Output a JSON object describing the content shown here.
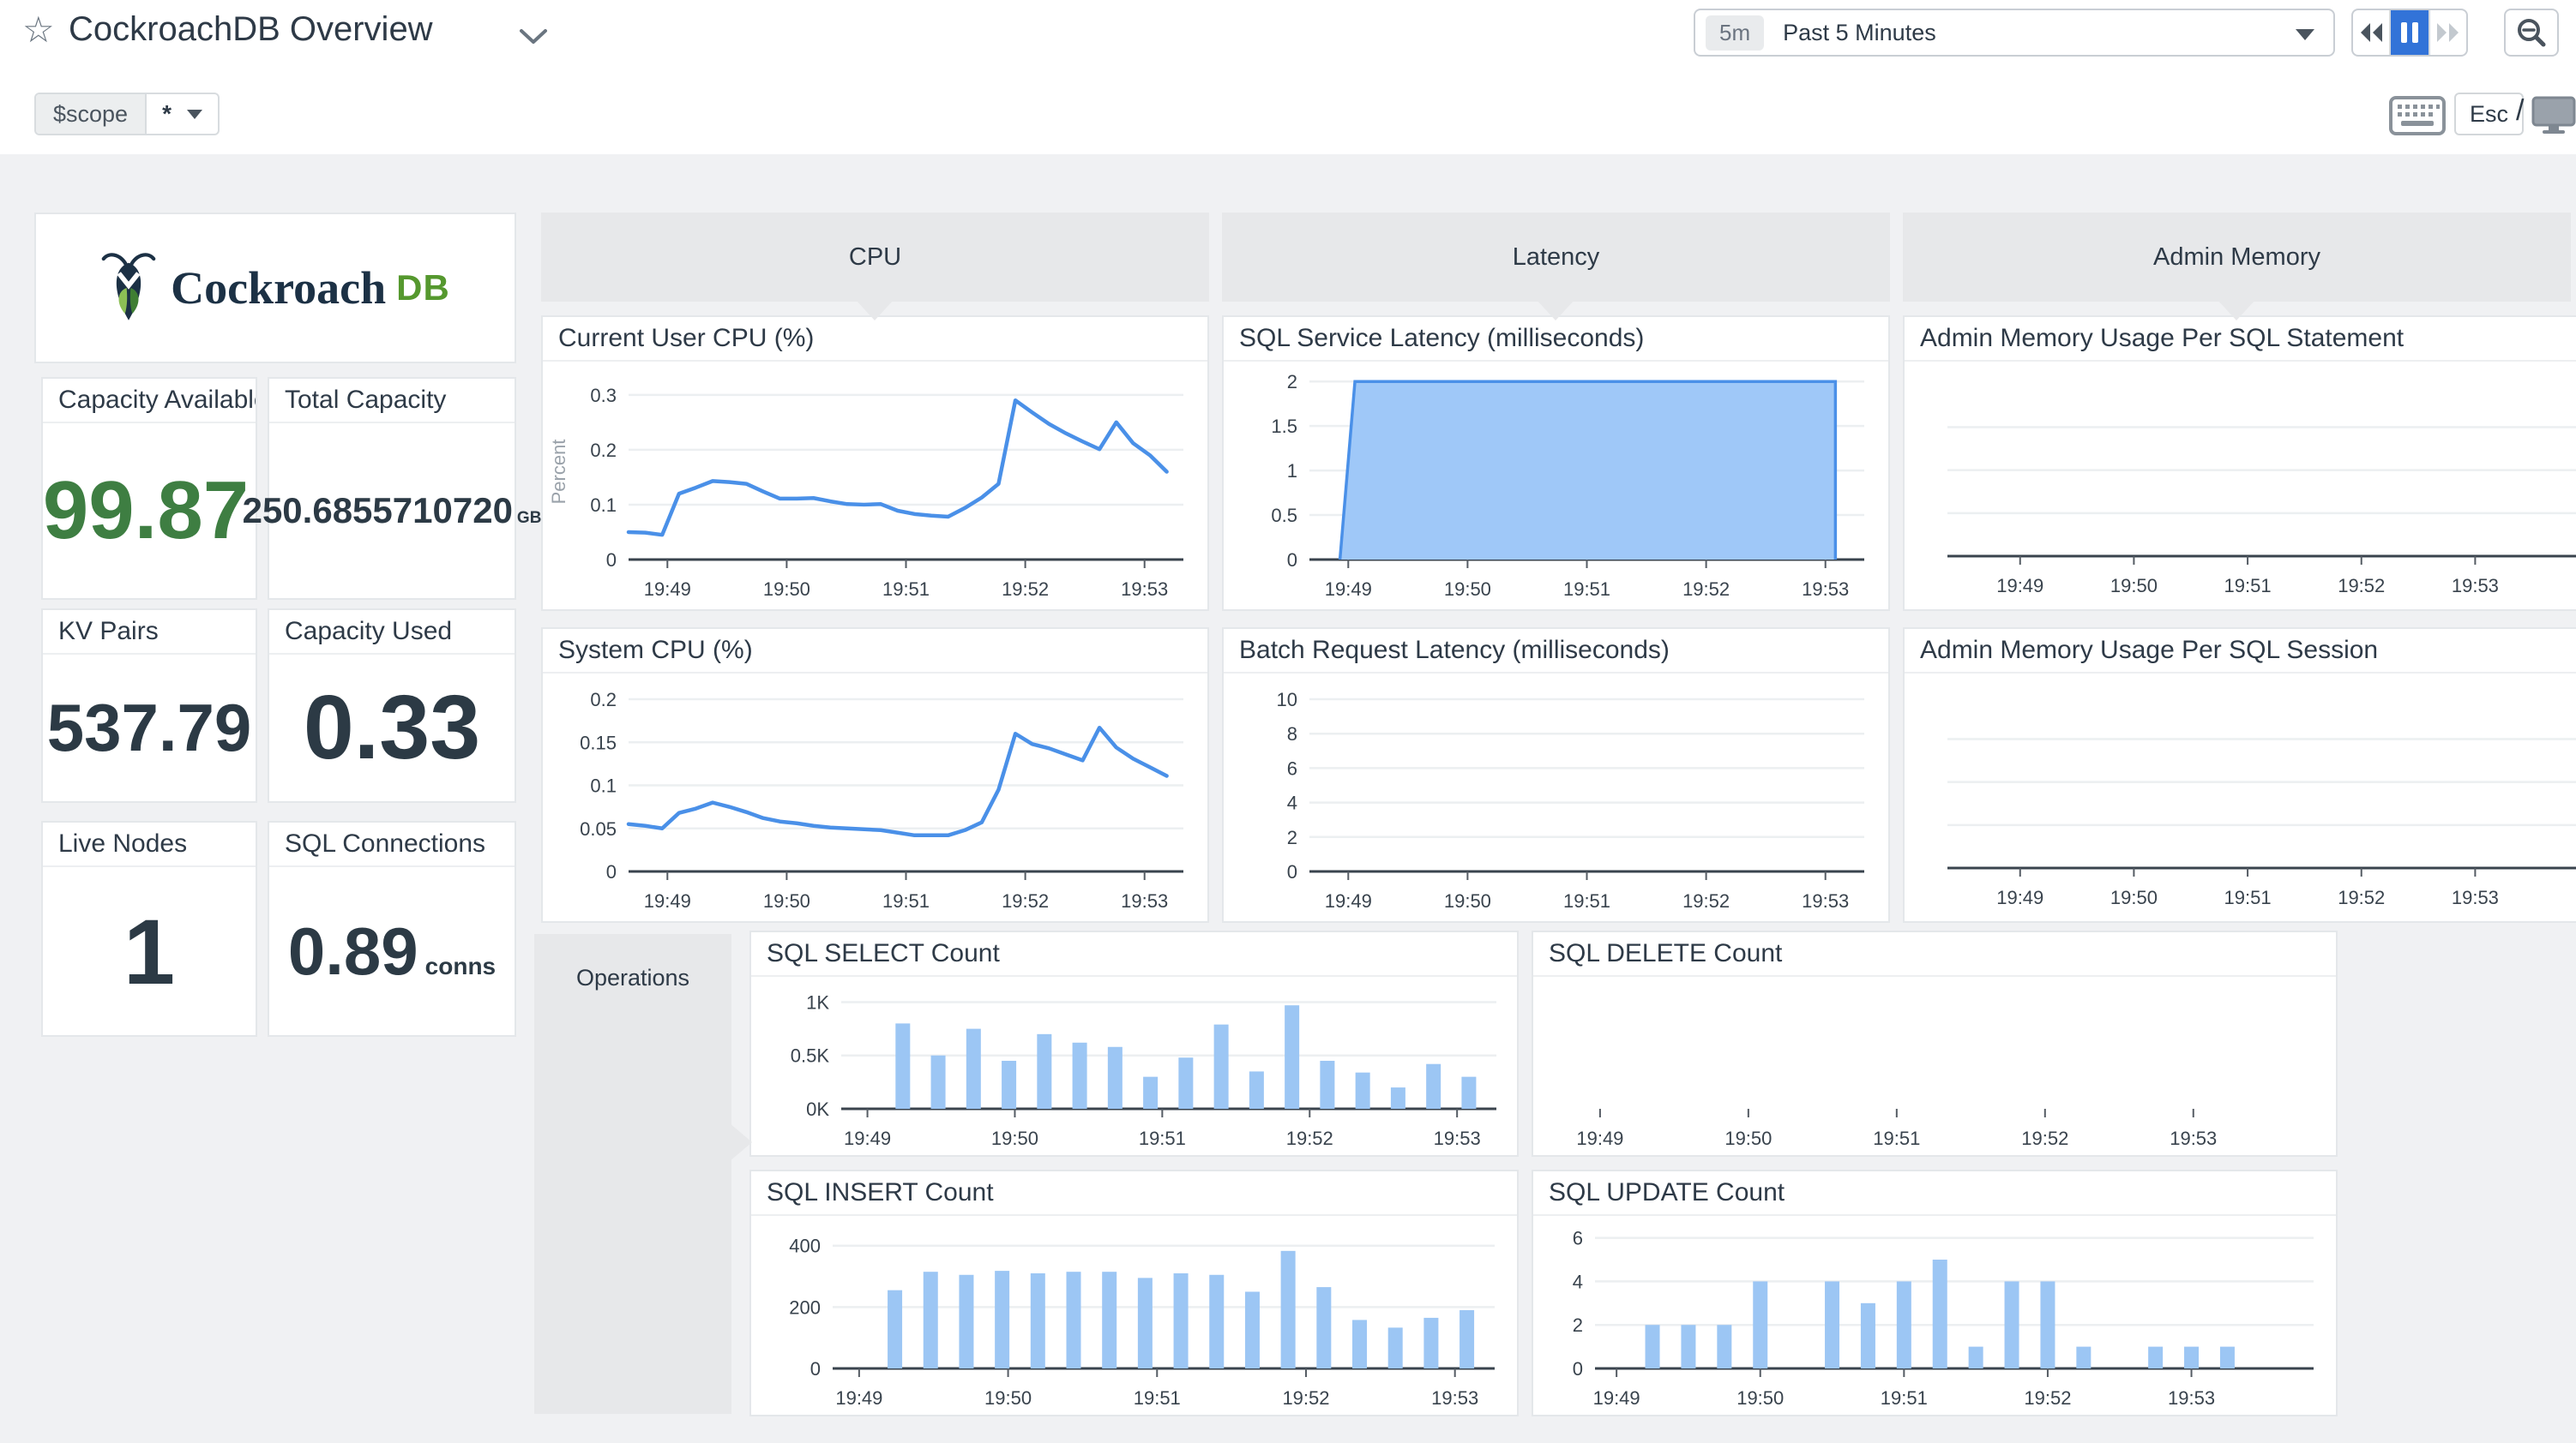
{
  "header": {
    "title": "CockroachDB Overview",
    "time_badge": "5m",
    "time_label": "Past 5 Minutes",
    "esc_label": "Esc",
    "slash": "/"
  },
  "template_vars": {
    "scope_label": "$scope",
    "scope_value": "*"
  },
  "branding": {
    "logo_text": "Cockroach",
    "logo_suffix": "DB"
  },
  "groups": {
    "cpu": "CPU",
    "latency": "Latency",
    "admin_memory": "Admin Memory",
    "operations": "Operations"
  },
  "stats": [
    {
      "id": "capacity-available",
      "title": "Capacity Available...",
      "value": "99.87",
      "unit": ""
    },
    {
      "id": "total-capacity",
      "title": "Total Capacity",
      "value": "250.6855710720",
      "unit": "GB"
    },
    {
      "id": "kv-pairs",
      "title": "KV Pairs",
      "value": "537.79",
      "unit": ""
    },
    {
      "id": "capacity-used",
      "title": "Capacity Used",
      "value": "0.33",
      "unit": ""
    },
    {
      "id": "live-nodes",
      "title": "Live Nodes",
      "value": "1",
      "unit": ""
    },
    {
      "id": "sql-connections",
      "title": "SQL Connections",
      "value": "0.89",
      "unit": "conns"
    }
  ],
  "colors": {
    "accent_blue": "#4a90e8",
    "area_fill": "#9fc8f8",
    "bar_fill": "#9cc6f4",
    "value_green": "#3e7e42",
    "value_navy": "#2c3a45",
    "header_gray": "#e7e8ea",
    "canvas_gray": "#f0f1f3",
    "active_blue": "#3273d8",
    "grid_line": "#eceff1",
    "axis_dark": "#39434d"
  },
  "chart_data": [
    {
      "id": "current-user-cpu",
      "type": "line",
      "title": "Current User CPU (%)",
      "ylabel": "Percent",
      "ylim": 0.32,
      "yticks": [
        {
          "v": 0,
          "l": "0"
        },
        {
          "v": 0.1,
          "l": "0.1"
        },
        {
          "v": 0.2,
          "l": "0.2"
        },
        {
          "v": 0.3,
          "l": "0.3"
        }
      ],
      "x_ticks": [
        "19:49",
        "19:50",
        "19:51",
        "19:52",
        "19:53"
      ],
      "values": [
        0.05,
        0.049,
        0.045,
        0.12,
        0.131,
        0.143,
        0.141,
        0.138,
        0.124,
        0.111,
        0.111,
        0.112,
        0.106,
        0.101,
        0.1,
        0.101,
        0.089,
        0.083,
        0.08,
        0.078,
        0.094,
        0.113,
        0.138,
        0.29,
        0.268,
        0.247,
        0.23,
        0.215,
        0.201,
        0.25,
        0.212,
        0.19,
        0.16
      ]
    },
    {
      "id": "system-cpu",
      "type": "line",
      "title": "System CPU (%)",
      "ylabel": "",
      "ylim": 0.21,
      "yticks": [
        {
          "v": 0,
          "l": "0"
        },
        {
          "v": 0.05,
          "l": "0.05"
        },
        {
          "v": 0.1,
          "l": "0.1"
        },
        {
          "v": 0.15,
          "l": "0.15"
        },
        {
          "v": 0.2,
          "l": "0.2"
        }
      ],
      "x_ticks": [
        "19:49",
        "19:50",
        "19:51",
        "19:52",
        "19:53"
      ],
      "values": [
        0.055,
        0.053,
        0.05,
        0.068,
        0.073,
        0.08,
        0.075,
        0.069,
        0.062,
        0.058,
        0.056,
        0.053,
        0.051,
        0.05,
        0.049,
        0.048,
        0.045,
        0.042,
        0.042,
        0.042,
        0.048,
        0.057,
        0.095,
        0.16,
        0.148,
        0.143,
        0.136,
        0.129,
        0.167,
        0.144,
        0.131,
        0.121,
        0.111
      ]
    },
    {
      "id": "sql-service-latency",
      "type": "area",
      "title": "SQL Service Latency (milliseconds)",
      "ylabel": "",
      "ylim": 2.05,
      "yticks": [
        {
          "v": 0,
          "l": "0"
        },
        {
          "v": 0.5,
          "l": "0.5"
        },
        {
          "v": 1,
          "l": "1"
        },
        {
          "v": 1.5,
          "l": "1.5"
        },
        {
          "v": 2,
          "l": "2"
        }
      ],
      "x_ticks": [
        "19:49",
        "19:50",
        "19:51",
        "19:52",
        "19:53"
      ],
      "polygon": [
        [
          0.055,
          0
        ],
        [
          0.082,
          2
        ],
        [
          0.948,
          2
        ],
        [
          0.948,
          0
        ]
      ]
    },
    {
      "id": "batch-request-latency",
      "type": "empty",
      "title": "Batch Request Latency (milliseconds)",
      "ylabel": "",
      "ylim": 10.4,
      "yticks": [
        {
          "v": 0,
          "l": "0"
        },
        {
          "v": 2,
          "l": "2"
        },
        {
          "v": 4,
          "l": "4"
        },
        {
          "v": 6,
          "l": "6"
        },
        {
          "v": 8,
          "l": "8"
        },
        {
          "v": 10,
          "l": "10"
        }
      ],
      "x_ticks": [
        "19:49",
        "19:50",
        "19:51",
        "19:52",
        "19:53"
      ]
    },
    {
      "id": "admin-memory-statement",
      "type": "empty",
      "title": "Admin Memory Usage Per SQL Statement",
      "ylabel": "",
      "ylim": 1,
      "yticks": [
        {
          "v": 0.26
        },
        {
          "v": 0.52
        },
        {
          "v": 0.78
        }
      ],
      "x_ticks": [
        "19:49",
        "19:50",
        "19:51",
        "19:52",
        "19:53"
      ]
    },
    {
      "id": "admin-memory-session",
      "type": "empty",
      "title": "Admin Memory Usage Per SQL Session",
      "ylabel": "",
      "ylim": 1,
      "yticks": [
        {
          "v": 0.26
        },
        {
          "v": 0.52
        },
        {
          "v": 0.78
        }
      ],
      "x_ticks": [
        "19:49",
        "19:50",
        "19:51",
        "19:52",
        "19:53"
      ]
    },
    {
      "id": "sql-select-count",
      "type": "bar",
      "title": "SQL SELECT Count",
      "ylabel": "",
      "ylim": 1060,
      "yticks": [
        {
          "v": 0,
          "l": "0K"
        },
        {
          "v": 500,
          "l": "0.5K"
        },
        {
          "v": 1000,
          "l": "1K"
        }
      ],
      "x_ticks": [
        "19:49",
        "19:50",
        "19:51",
        "19:52",
        "19:53"
      ],
      "values": [
        800,
        500,
        750,
        450,
        700,
        620,
        580,
        300,
        480,
        790,
        350,
        970,
        450,
        340,
        200,
        420,
        300
      ]
    },
    {
      "id": "sql-delete-count",
      "type": "empty",
      "title": "SQL DELETE Count",
      "ylabel": "",
      "ylim": 1,
      "yticks": [],
      "x_ticks": [
        "19:49",
        "19:50",
        "19:51",
        "19:52",
        "19:53"
      ]
    },
    {
      "id": "sql-insert-count",
      "type": "bar",
      "title": "SQL INSERT Count",
      "ylabel": "",
      "ylim": 430,
      "yticks": [
        {
          "v": 0,
          "l": "0"
        },
        {
          "v": 200,
          "l": "200"
        },
        {
          "v": 400,
          "l": "400"
        }
      ],
      "x_ticks": [
        "19:49",
        "19:50",
        "19:51",
        "19:52",
        "19:53"
      ],
      "values": [
        255,
        315,
        305,
        318,
        310,
        315,
        315,
        295,
        310,
        305,
        250,
        383,
        265,
        158,
        133,
        165,
        190
      ]
    },
    {
      "id": "sql-update-count",
      "type": "bar",
      "title": "SQL UPDATE Count",
      "ylabel": "",
      "ylim": 6.3,
      "yticks": [
        {
          "v": 0,
          "l": "0"
        },
        {
          "v": 2,
          "l": "2"
        },
        {
          "v": 4,
          "l": "4"
        },
        {
          "v": 6,
          "l": "6"
        }
      ],
      "x_ticks": [
        "19:49",
        "19:50",
        "19:51",
        "19:52",
        "19:53"
      ],
      "values": [
        2,
        2,
        2,
        4,
        0,
        4,
        3,
        4,
        5,
        1,
        4,
        4,
        1,
        0,
        1,
        1,
        1
      ]
    }
  ]
}
